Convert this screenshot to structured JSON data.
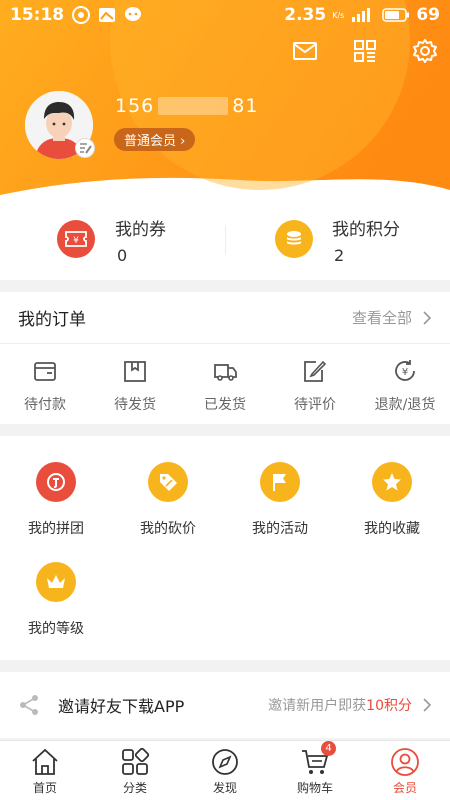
{
  "status_bar": {
    "time": "15:18",
    "speed": "2.35",
    "speed_unit": "K/s",
    "battery": "69"
  },
  "profile": {
    "phone_prefix": "156",
    "phone_suffix": "81",
    "member_level": "普通会员 ›"
  },
  "assets": {
    "coupons": {
      "label": "我的券",
      "value": "0",
      "icon": "ticket-icon"
    },
    "points": {
      "label": "我的积分",
      "value": "2",
      "icon": "coins-icon"
    }
  },
  "orders": {
    "title": "我的订单",
    "view_all": "查看全部",
    "items": [
      {
        "label": "待付款",
        "icon": "wallet-icon"
      },
      {
        "label": "待发货",
        "icon": "box-icon"
      },
      {
        "label": "已发货",
        "icon": "truck-icon"
      },
      {
        "label": "待评价",
        "icon": "edit-icon"
      },
      {
        "label": "退款/退货",
        "icon": "refund-icon"
      }
    ]
  },
  "services": [
    {
      "label": "我的拼团",
      "icon": "group-buy-icon",
      "color": "#e94d3c"
    },
    {
      "label": "我的砍价",
      "icon": "price-tag-icon",
      "color": "#f8b41c"
    },
    {
      "label": "我的活动",
      "icon": "flag-icon",
      "color": "#f8b41c"
    },
    {
      "label": "我的收藏",
      "icon": "star-icon",
      "color": "#f8b41c"
    },
    {
      "label": "我的等级",
      "icon": "crown-icon",
      "color": "#f8b41c"
    }
  ],
  "invite": {
    "title": "邀请好友下载APP",
    "reward_prefix": "邀请新用户即获",
    "reward_highlight": "10积分"
  },
  "tabs": [
    {
      "label": "首页",
      "icon": "home-icon"
    },
    {
      "label": "分类",
      "icon": "category-icon"
    },
    {
      "label": "发现",
      "icon": "compass-icon"
    },
    {
      "label": "购物车",
      "icon": "cart-icon",
      "badge": "4"
    },
    {
      "label": "会员",
      "icon": "member-icon",
      "active": true
    }
  ],
  "colors": {
    "brand_orange": "#ff9a1a",
    "accent_red": "#e94d3c",
    "gold": "#f8b41c"
  }
}
